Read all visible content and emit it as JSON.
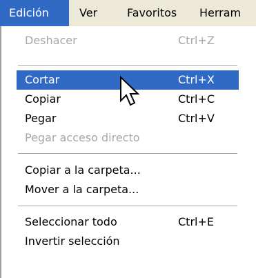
{
  "menubar": {
    "items": [
      {
        "label": "Edición"
      },
      {
        "label": "Ver"
      },
      {
        "label": "Favoritos"
      },
      {
        "label": "Herram"
      }
    ]
  },
  "menu": {
    "items": [
      {
        "label": "Deshacer",
        "shortcut": "Ctrl+Z"
      },
      {
        "label": "Cortar",
        "shortcut": "Ctrl+X"
      },
      {
        "label": "Copiar",
        "shortcut": "Ctrl+C"
      },
      {
        "label": "Pegar",
        "shortcut": "Ctrl+V"
      },
      {
        "label": "Pegar acceso directo"
      },
      {
        "label": "Copiar a la carpeta..."
      },
      {
        "label": "Mover a la carpeta..."
      },
      {
        "label": "Seleccionar todo",
        "shortcut": "Ctrl+E"
      },
      {
        "label": "Invertir selección"
      }
    ]
  },
  "icons": {
    "pointer": "mouse-pointer-icon"
  },
  "colors": {
    "highlight": "#316ac5",
    "menubar_bg": "#ece9d8",
    "disabled_text": "#a7a6aa"
  }
}
